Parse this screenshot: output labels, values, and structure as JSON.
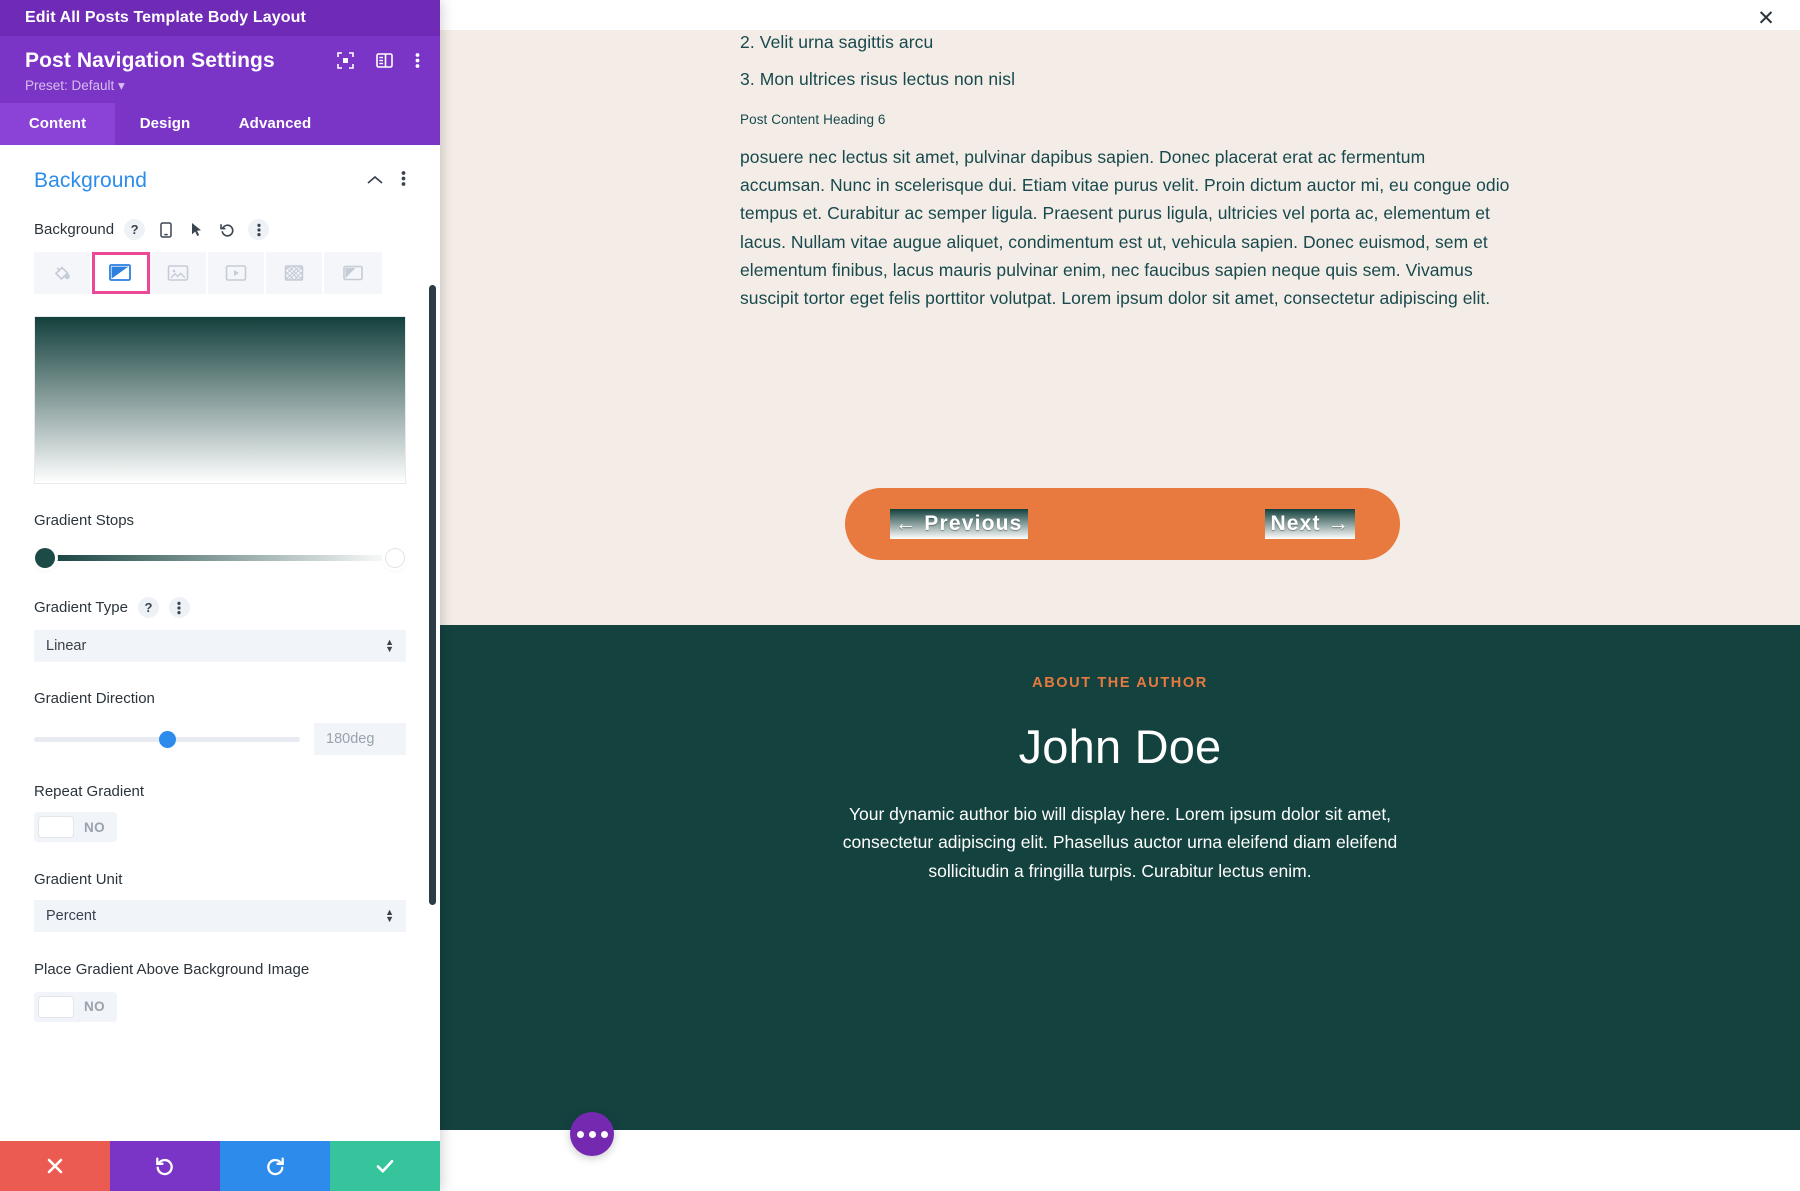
{
  "window": {
    "title": "Edit All Posts Template Body Layout",
    "close_icon": "close-icon"
  },
  "panel": {
    "heading": "Post Navigation Settings",
    "preset": "Preset: Default ▾",
    "header_icons": [
      "expand-icon",
      "layout-columns-icon",
      "kebab-menu-icon"
    ],
    "tabs": [
      {
        "label": "Content",
        "active": true
      },
      {
        "label": "Design",
        "active": false
      },
      {
        "label": "Advanced",
        "active": false
      }
    ],
    "section": {
      "title": "Background",
      "collapse_icon": "chevron-up-icon",
      "menu_icon": "kebab-menu-icon"
    },
    "background_field": {
      "label": "Background",
      "icons": [
        "help-icon",
        "responsive-icon",
        "hover-icon",
        "reset-icon",
        "kebab-menu-icon"
      ],
      "types": [
        {
          "name": "background-color",
          "active": false
        },
        {
          "name": "background-gradient",
          "active": true
        },
        {
          "name": "background-image",
          "active": false
        },
        {
          "name": "background-video",
          "active": false
        },
        {
          "name": "background-pattern",
          "active": false
        },
        {
          "name": "background-mask",
          "active": false
        }
      ]
    },
    "gradient": {
      "preview_start_color": "#13403c",
      "preview_end_color": "#ffffff",
      "stops_label": "Gradient Stops",
      "stop_a_color": "#1c4a47",
      "stop_b_color": "#ffffff",
      "type_label": "Gradient Type",
      "type_value": "Linear",
      "direction_label": "Gradient Direction",
      "direction_value": "180deg",
      "direction_percent": 50,
      "repeat_label": "Repeat Gradient",
      "repeat_value": "NO",
      "unit_label": "Gradient Unit",
      "unit_value": "Percent",
      "place_above_label": "Place Gradient Above Background Image",
      "place_above_value": "NO"
    },
    "footer": [
      {
        "name": "cancel-button",
        "icon": "✕",
        "color": "#ec5b52"
      },
      {
        "name": "undo-button",
        "icon": "↺",
        "color": "#7b35c6"
      },
      {
        "name": "redo-button",
        "icon": "↻",
        "color": "#2d8ceb"
      },
      {
        "name": "save-button",
        "icon": "✓",
        "color": "#36c49c"
      }
    ]
  },
  "preview": {
    "list_items": [
      "2. Velit urna sagittis arcu",
      "3. Mon ultrices risus lectus non nisl"
    ],
    "heading6": "Post Content Heading 6",
    "paragraph": "posuere nec lectus sit amet, pulvinar dapibus sapien. Donec placerat erat ac fermentum accumsan. Nunc in scelerisque dui. Etiam vitae purus velit. Proin dictum auctor mi, eu congue odio tempus et. Curabitur ac semper ligula. Praesent purus ligula, ultricies vel porta ac, elementum et lacus. Nullam vitae augue aliquet, condimentum est ut, vehicula sapien. Donec euismod, sem et elementum finibus, lacus mauris pulvinar enim, nec faucibus sapien neque quis sem. Vivamus suscipit tortor eget felis porttitor volutpat. Lorem ipsum dolor sit amet, consectetur adipiscing elit.",
    "post_nav": {
      "previous": "← Previous",
      "next": "Next →",
      "bar_color": "#e8793f"
    },
    "author": {
      "eyebrow": "ABOUT THE AUTHOR",
      "name": "John Doe",
      "bio": "Your dynamic author bio will display here. Lorem ipsum dolor sit amet, consectetur adipiscing elit. Phasellus auctor urna eleifend diam eleifend sollicitudin a fringilla turpis. Curabitur lectus enim.",
      "bg_color": "#14423f",
      "accent_color": "#e8793f"
    },
    "fab": {
      "name": "more-options-fab",
      "color": "#7528b0"
    }
  }
}
